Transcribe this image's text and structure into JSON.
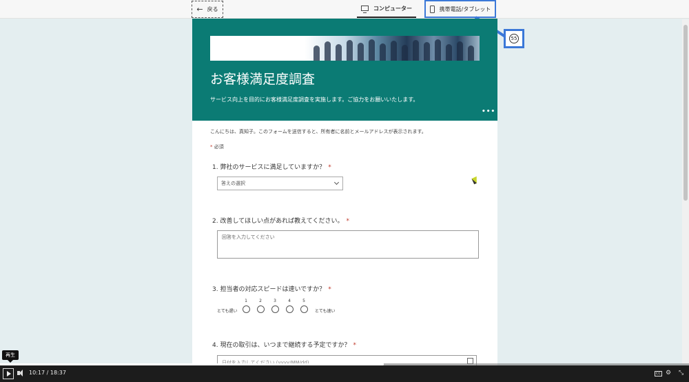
{
  "toolbar": {
    "back_label": "戻る",
    "computer_label": "コンピューター",
    "mobile_label": "携帯電話/タブレット"
  },
  "callout": {
    "number": "55"
  },
  "form": {
    "title": "お客様満足度調査",
    "description": "サービス向上を目的にお客様満足度調査を実施します。ご協力をお願いいたします。",
    "more": "•••",
    "intro": "こんにちは、真知子。このフォームを送信すると、所有者に名前とメールアドレスが表示されます。",
    "required_note": "必須",
    "questions": [
      {
        "label": "1. 弊社のサービスに満足していますか？",
        "placeholder": "答えの選択"
      },
      {
        "label": "2. 改善してほしい点があれば教えてください。",
        "placeholder": "回答を入力してください"
      },
      {
        "label": "3. 担当者の対応スピードは速いですか？",
        "low_label": "とても遅い",
        "high_label": "とても速い",
        "scale": [
          "1",
          "2",
          "3",
          "4",
          "5"
        ]
      },
      {
        "label": "4. 現在の取引は、いつまで継続する予定ですか？",
        "placeholder": "日付を入力してください (yyyy/MM/dd)"
      }
    ]
  },
  "player": {
    "tooltip": "再生",
    "current_time": "10:17",
    "separator": "/",
    "total_time": "18:37",
    "progress": 0.553
  },
  "colors": {
    "header_bg": "#0b7b74",
    "callout": "#3b78d8",
    "required": "#c0392b"
  }
}
